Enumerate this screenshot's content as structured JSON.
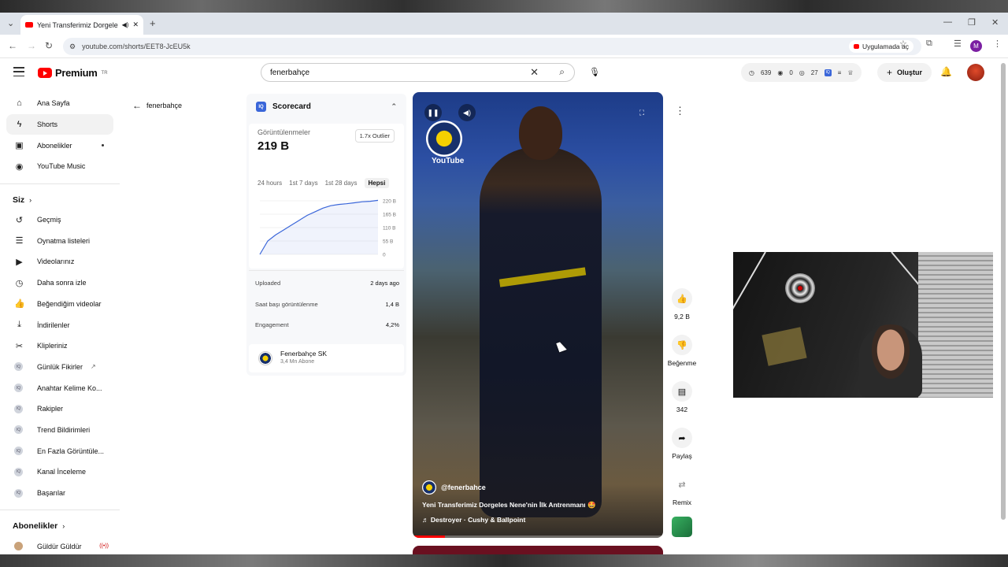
{
  "browser": {
    "tab_title": "Yeni Transferimiz Dorgeles",
    "url": "youtube.com/shorts/EET8-JcEU5k",
    "open_in_app": "Uygulamada aç",
    "profile_initial": "M"
  },
  "header": {
    "logo_text": "Premium",
    "logo_region": "TR",
    "search_value": "fenerbahçe",
    "stats": {
      "a": "639",
      "b": "0",
      "c": "27"
    },
    "create_label": "Oluştur"
  },
  "sidebar": {
    "main": [
      {
        "label": "Ana Sayfa",
        "icon": "home-icon"
      },
      {
        "label": "Shorts",
        "icon": "shorts-icon"
      },
      {
        "label": "Abonelikler",
        "icon": "subscriptions-icon"
      },
      {
        "label": "YouTube Music",
        "icon": "music-icon"
      }
    ],
    "you_header": "Siz",
    "you": [
      {
        "label": "Geçmiş"
      },
      {
        "label": "Oynatma listeleri"
      },
      {
        "label": "Videolarınız"
      },
      {
        "label": "Daha sonra izle"
      },
      {
        "label": "Beğendiğim videolar"
      },
      {
        "label": "İndirilenler"
      },
      {
        "label": "Klipleriniz"
      },
      {
        "label": "Günlük Fikirler"
      },
      {
        "label": "Anahtar Kelime Ko..."
      },
      {
        "label": "Rakipler"
      },
      {
        "label": "Trend Bildirimleri"
      },
      {
        "label": "En Fazla Görüntüle..."
      },
      {
        "label": "Kanal İnceleme"
      },
      {
        "label": "Başarılar"
      }
    ],
    "subs_header": "Abonelikler",
    "subs": [
      {
        "label": "Güldür Güldür"
      }
    ]
  },
  "back_label": "fenerbahçe",
  "scorecard": {
    "title": "Scorecard",
    "views_label": "Görüntülenmeler",
    "views_value": "219 B",
    "outlier": "1.7x Outlier",
    "ranges": [
      "24 hours",
      "1st 7 days",
      "1st 28 days",
      "Hepsi"
    ],
    "y_ticks": [
      "220 B",
      "165 B",
      "110 B",
      "55 B",
      "0"
    ],
    "uploaded_label": "Uploaded",
    "uploaded_value": "2 days ago",
    "per_hour_label": "Saat başı görüntülenme",
    "per_hour_value": "1,4 B",
    "engagement_label": "Engagement",
    "engagement_value": "4,2%",
    "channel_name": "Fenerbahçe SK",
    "channel_subs": "3,4 Mn Abone"
  },
  "chart_data": {
    "type": "line",
    "x": [
      0,
      1,
      2,
      3,
      4,
      5,
      6,
      7,
      8,
      9,
      10,
      11,
      12,
      13,
      14,
      15
    ],
    "values": [
      0,
      55,
      80,
      100,
      120,
      140,
      160,
      175,
      190,
      200,
      205,
      208,
      212,
      216,
      218,
      222
    ],
    "ylim": [
      0,
      220
    ],
    "y_ticks": [
      "220 B",
      "165 B",
      "110 B",
      "55 B",
      "0"
    ]
  },
  "video": {
    "watermark": "YouTube",
    "channel_handle": "@fenerbahce",
    "title": "Yeni Transferimiz Dorgeles Nene'nin İlk Antrenmanı 🤩",
    "music": "♬ Destroyer · Cushy & Ballpoint",
    "progress": 0.13
  },
  "actions": {
    "like_count": "9,2 B",
    "dislike_label": "Beğenme",
    "comment_count": "342",
    "share_label": "Paylaş",
    "remix_label": "Remix"
  }
}
